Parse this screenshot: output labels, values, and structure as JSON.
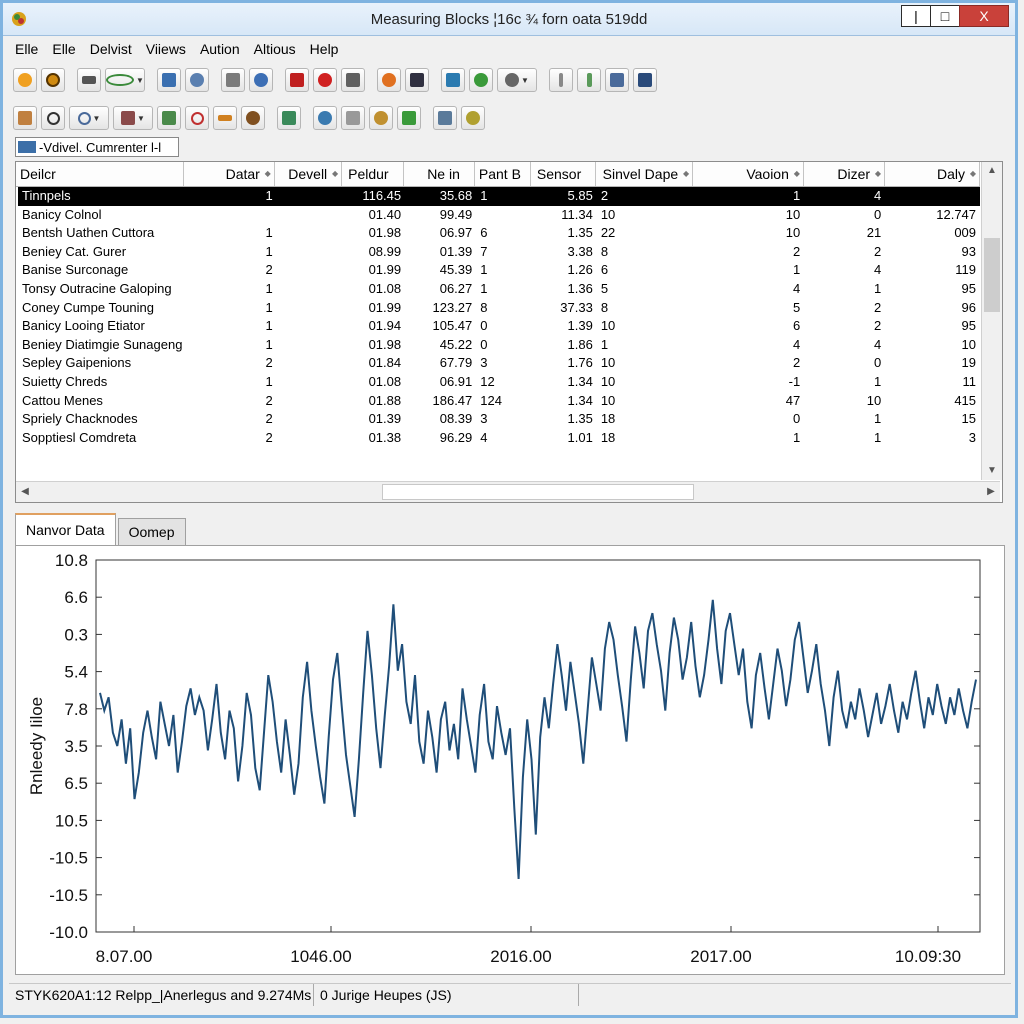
{
  "window": {
    "title": "Measuring Blocks ¦16c ¾ forn oata 519dd",
    "minimize": "|",
    "maximize": "□",
    "close": "X"
  },
  "menu": [
    "Elle",
    "Elle",
    "Delvist",
    "Viiews",
    "Aution",
    "Altious",
    "Help"
  ],
  "combo": {
    "value": "-Vdivel. Cumrenter l-l"
  },
  "table": {
    "columns": [
      "Deilcr",
      "Datar",
      "Devell",
      "Peldur",
      "Ne in",
      "Pant B",
      "Sensor",
      "Sinvel Dape",
      "Vaoion",
      "Dizer",
      "Daly"
    ],
    "rows": [
      [
        "Tinnpels",
        "1",
        "",
        "116.45",
        "35.68",
        "1",
        "5.85",
        "2",
        "1",
        "4",
        ""
      ],
      [
        "Banicy Colnol",
        "",
        "",
        "01.40",
        "99.49",
        "",
        "11.34",
        "10",
        "10",
        "0",
        "12.747"
      ],
      [
        "Bentsh Uathen Cuttora",
        "1",
        "",
        "01.98",
        "06.97",
        "6",
        "1.35",
        "22",
        "10",
        "21",
        "009"
      ],
      [
        "Beniey Cat. Gurer",
        "1",
        "",
        "08.99",
        "01.39",
        "7",
        "3.38",
        "8",
        "2",
        "2",
        "93"
      ],
      [
        "Banise Surconage",
        "2",
        "",
        "01.99",
        "45.39",
        "1",
        "1.26",
        "6",
        "1",
        "4",
        "119"
      ],
      [
        "Tonsy Outracine Galoping",
        "1",
        "",
        "01.08",
        "06.27",
        "1",
        "1.36",
        "5",
        "4",
        "1",
        "95"
      ],
      [
        "Coney Cumpe Touning",
        "1",
        "",
        "01.99",
        "123.27",
        "8",
        "37.33",
        "8",
        "5",
        "2",
        "96"
      ],
      [
        "Banicy Looing Etiator",
        "1",
        "",
        "01.94",
        "105.47",
        "0",
        "1.39",
        "10",
        "6",
        "2",
        "95"
      ],
      [
        "Beniey Diatimgie Sunageng",
        "1",
        "",
        "01.98",
        "45.22",
        "0",
        "1.86",
        "1",
        "4",
        "4",
        "10"
      ],
      [
        "Sepley Gaipenions",
        "2",
        "",
        "01.84",
        "67.79",
        "3",
        "1.76",
        "10",
        "2",
        "0",
        "19"
      ],
      [
        "Suietty Chreds",
        "1",
        "",
        "01.08",
        "06.91",
        "12",
        "1.34",
        "10",
        "-1",
        "1",
        "11"
      ],
      [
        "Cattou Menes",
        "2",
        "",
        "01.88",
        "186.47",
        "124",
        "1.34",
        "10",
        "47",
        "10",
        "415"
      ],
      [
        "Spriely Chacknodes",
        "2",
        "",
        "01.39",
        "08.39",
        "3",
        "1.35",
        "18",
        "0",
        "1",
        "15"
      ],
      [
        "Sopptiesl Comdreta",
        "2",
        "",
        "01.38",
        "96.29",
        "4",
        "1.01",
        "18",
        "1",
        "1",
        "3"
      ]
    ]
  },
  "tabs": [
    "Nanvor Data",
    "Oomep"
  ],
  "chart_data": {
    "type": "line",
    "title": "",
    "xlabel": "",
    "ylabel": "Rnleedy Iiloe",
    "y_tick_labels": [
      "10.8",
      "6.6",
      "0.3",
      "5.4",
      "7.8",
      "3.5",
      "6.5",
      "10.5",
      "-10.5",
      "-10.5",
      "-10.0"
    ],
    "x_tick_labels": [
      "8.07.00",
      "1046.00",
      "2016.00",
      "2017.00",
      "10.09:30"
    ],
    "grid": false,
    "legend": "none",
    "line_color": "#1f4e79",
    "series": [
      {
        "values": [
          5.4,
          5.0,
          5.3,
          4.5,
          4.2,
          4.8,
          3.8,
          4.6,
          3.0,
          3.6,
          4.5,
          5.0,
          4.4,
          3.9,
          5.2,
          4.7,
          4.2,
          4.9,
          3.6,
          4.3,
          5.1,
          5.5,
          4.9,
          5.3,
          5.0,
          4.1,
          4.8,
          5.6,
          4.5,
          3.9,
          5.0,
          4.6,
          3.4,
          4.2,
          5.4,
          4.9,
          3.7,
          3.2,
          4.5,
          5.8,
          5.2,
          4.3,
          3.6,
          4.8,
          4.0,
          3.1,
          3.8,
          5.3,
          6.1,
          5.0,
          4.2,
          3.5,
          2.9,
          4.4,
          5.7,
          6.3,
          5.1,
          4.0,
          3.3,
          2.6,
          3.9,
          5.4,
          6.8,
          5.8,
          4.6,
          3.7,
          4.9,
          6.0,
          7.4,
          5.9,
          6.5,
          5.2,
          4.7,
          5.8,
          4.3,
          3.8,
          5.0,
          4.4,
          3.6,
          4.8,
          5.2,
          4.1,
          4.7,
          3.9,
          5.5,
          4.8,
          4.2,
          3.6,
          4.9,
          5.6,
          4.3,
          3.9,
          5.1,
          4.5,
          4.0,
          4.6,
          2.8,
          1.2,
          3.5,
          4.8,
          3.9,
          2.2,
          4.4,
          5.3,
          4.6,
          5.6,
          6.5,
          5.8,
          5.0,
          6.1,
          5.4,
          4.7,
          3.8,
          5.0,
          6.2,
          5.6,
          5.0,
          6.4,
          7.0,
          6.6,
          5.8,
          5.1,
          4.3,
          5.7,
          6.9,
          6.3,
          5.5,
          6.8,
          7.2,
          6.5,
          5.9,
          5.0,
          6.3,
          7.1,
          6.6,
          5.7,
          6.2,
          7.0,
          6.0,
          5.3,
          5.8,
          6.6,
          7.5,
          6.4,
          5.6,
          6.8,
          7.2,
          6.5,
          5.8,
          6.4,
          5.2,
          4.6,
          5.8,
          6.3,
          5.5,
          4.8,
          5.6,
          6.4,
          5.9,
          5.1,
          5.7,
          6.6,
          7.0,
          6.2,
          5.4,
          5.9,
          6.5,
          5.6,
          5.0,
          4.2,
          5.3,
          5.9,
          5.0,
          4.6,
          5.2,
          4.8,
          5.5,
          5.0,
          4.4,
          4.9,
          5.4,
          4.7,
          5.1,
          5.6,
          5.0,
          4.5,
          5.2,
          4.8,
          5.4,
          5.9,
          5.2,
          4.6,
          5.3,
          4.9,
          5.6,
          5.1,
          4.7,
          5.3,
          4.9,
          5.5,
          5.0,
          4.6,
          5.2,
          5.7
        ]
      }
    ]
  },
  "status": {
    "left": "STYK620A1:12 Relpp_|Anerlegus and 9.274Ms",
    "middle": "0 Jurige Heupes (JS)",
    "right": ""
  }
}
